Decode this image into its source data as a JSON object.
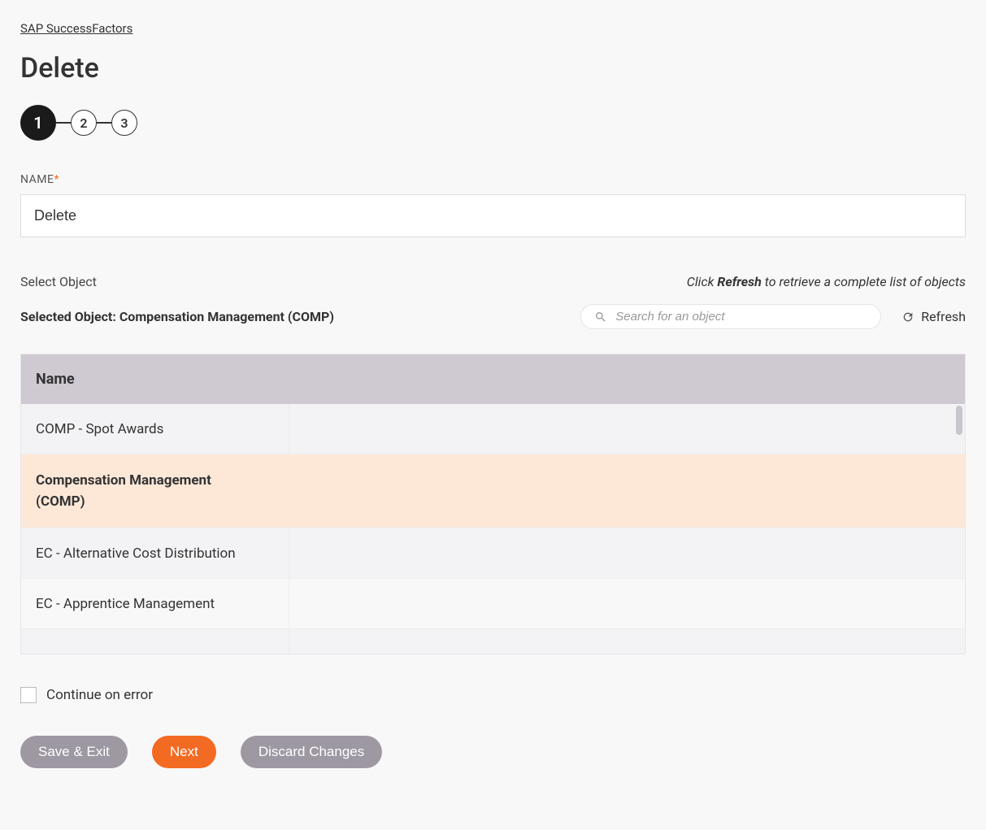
{
  "breadcrumb": "SAP SuccessFactors",
  "page_title": "Delete",
  "stepper": {
    "steps": [
      "1",
      "2",
      "3"
    ],
    "active": 0
  },
  "name_field": {
    "label": "NAME",
    "value": "Delete"
  },
  "select_object": {
    "label": "Select Object",
    "hint_prefix": "Click ",
    "hint_bold": "Refresh",
    "hint_suffix": " to retrieve a complete list of objects",
    "selected_prefix": "Selected Object: ",
    "selected_value": "Compensation Management (COMP)",
    "search_placeholder": "Search for an object",
    "refresh_label": "Refresh"
  },
  "table": {
    "header": "Name",
    "rows": [
      {
        "name": "COMP - Spot Awards",
        "selected": false
      },
      {
        "name_line1": "Compensation Management",
        "name_line2": "(COMP)",
        "selected": true
      },
      {
        "name": "EC - Alternative Cost Distribution",
        "selected": false
      },
      {
        "name": "EC - Apprentice Management",
        "selected": false
      }
    ]
  },
  "continue_checkbox": {
    "label": "Continue on error",
    "checked": false
  },
  "buttons": {
    "save_exit": "Save & Exit",
    "next": "Next",
    "discard": "Discard Changes"
  }
}
